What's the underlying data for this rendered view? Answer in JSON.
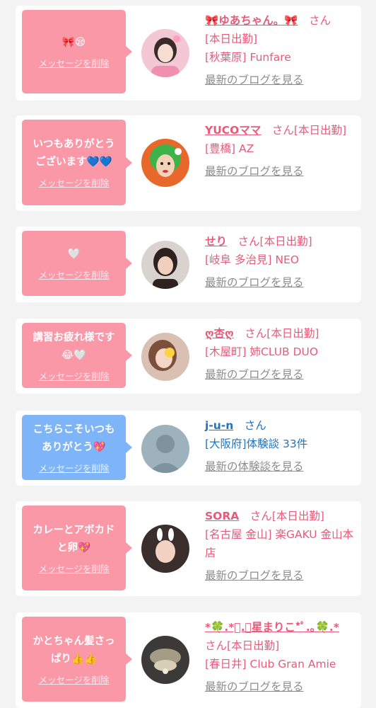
{
  "delete_label": "メッセージを削除",
  "colors": {
    "pink": "#fb98a8",
    "blue": "#7eb4f8",
    "name_pink": "#e85a7a",
    "name_blue": "#1f73c4"
  },
  "cards": [
    {
      "message": "🎀😪",
      "name": "🎀ゆあちゃん。🎀",
      "san": "さん",
      "status": "[本日出勤]",
      "shop": "[秋葉原] Funfare",
      "link": "最新のブログを見る",
      "avatar": "girl-photo-pink-outfit"
    },
    {
      "message": "いつもありがとう\nございます💙💙",
      "name": "YUCOママ",
      "san": "さん",
      "status": "[本日出勤]",
      "shop": "[豊橋] AZ",
      "link": "最新のブログを見る",
      "avatar": "green-hair-illustration"
    },
    {
      "message": "🤍",
      "name": "せり",
      "san": "さん",
      "status": "[本日出勤]",
      "shop": "[岐阜 多治見] NEO",
      "link": "最新のブログを見る",
      "avatar": "girl-photo-dark-hair"
    },
    {
      "message": "講習お疲れ様です\n😂🤍",
      "name": "ღ杏ღ",
      "san": "さん",
      "status": "[本日出勤]",
      "shop": "[木屋町] 姉CLUB DUO",
      "link": "最新のブログを見る",
      "avatar": "girl-photo-brown-hair"
    },
    {
      "message": "こちらこそいつも\nありがとう💖",
      "name": "j-u-n",
      "san": "さん",
      "status": "",
      "shop": "[大阪府]体験談 33件",
      "link": "最新の体験談を見る",
      "avatar": "no-photo-silhouette"
    },
    {
      "message": "カレーとアボカド\nと卵💖",
      "name": "SORA",
      "san": "さん",
      "status": "[本日出勤]",
      "shop": "[名古屋 金山] 楽GAKU 金山本店",
      "link": "最新のブログを見る",
      "avatar": "girl-photo-bunny-ears"
    },
    {
      "message": "かとちゃん髪さっ\nぱり👍👍",
      "name": "*🍀.*ﾟ.｡星まりこ*ﾟ.｡🍀.*",
      "san": "さん",
      "status": "[本日出勤]",
      "shop": "[春日井] Club Gran Amie",
      "link": "最新のブログを見る",
      "avatar": "chandelier-photo"
    }
  ]
}
